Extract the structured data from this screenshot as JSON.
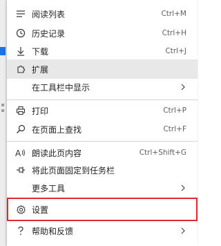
{
  "menu": {
    "items": [
      {
        "label": "阅读列表",
        "shortcut": "Ctrl+M",
        "icon": "reading-list-icon"
      },
      {
        "label": "历史记录",
        "shortcut": "Ctrl+H",
        "icon": "history-icon"
      },
      {
        "label": "下载",
        "shortcut": "Ctrl+J",
        "icon": "download-icon"
      },
      {
        "label": "扩展",
        "shortcut": "",
        "icon": "extensions-icon"
      },
      {
        "label": "在工具栏中显示",
        "shortcut": "",
        "icon": ""
      },
      {
        "label": "打印",
        "shortcut": "Ctrl+P",
        "icon": "print-icon"
      },
      {
        "label": "在页面上查找",
        "shortcut": "Ctrl+F",
        "icon": "find-icon"
      },
      {
        "label": "朗读此页内容",
        "shortcut": "Ctrl+Shift+G",
        "icon": "read-aloud-icon"
      },
      {
        "label": "将此页面固定到任务栏",
        "shortcut": "",
        "icon": "pin-icon"
      },
      {
        "label": "更多工具",
        "shortcut": "",
        "icon": ""
      },
      {
        "label": "设置",
        "shortcut": "",
        "icon": "gear-icon"
      },
      {
        "label": "帮助和反馈",
        "shortcut": "",
        "icon": "help-icon"
      }
    ]
  },
  "colors": {
    "highlight_border": "#e0272f",
    "hover_bg": "#e8e8e8",
    "accent_blue": "#1a73e8"
  }
}
